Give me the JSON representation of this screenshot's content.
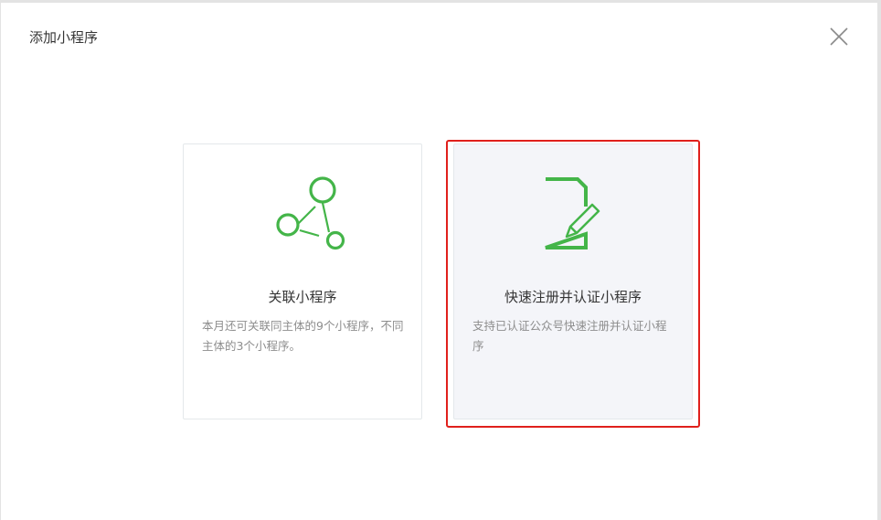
{
  "dialog": {
    "title": "添加小程序"
  },
  "cards": [
    {
      "title": "关联小程序",
      "description": "本月还可关联同主体的9个小程序，不同主体的3个小程序。",
      "icon": "share-network-icon"
    },
    {
      "title": "快速注册并认证小程序",
      "description": "支持已认证公众号快速注册并认证小程序",
      "icon": "document-edit-icon"
    }
  ],
  "colors": {
    "accent_green": "#44b549",
    "highlight_red": "#e0201c",
    "card_selected_bg": "#f4f5f9"
  }
}
